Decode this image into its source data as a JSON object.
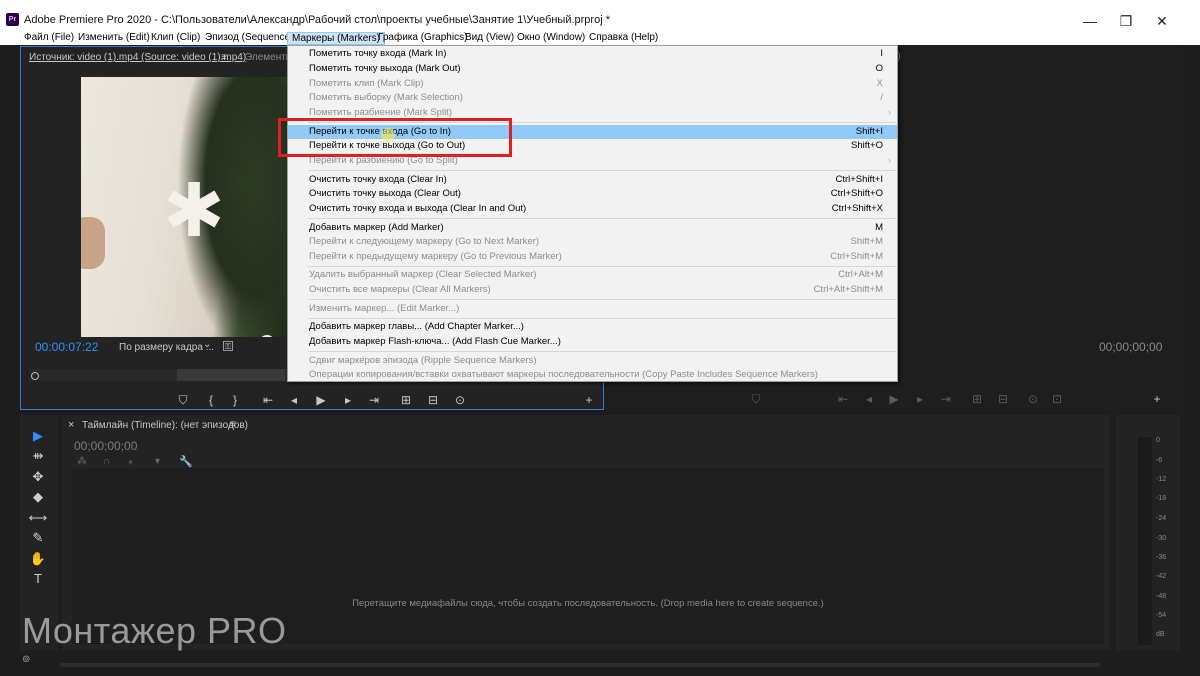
{
  "window": {
    "title": "Adobe Premiere Pro 2020 - C:\\Пользователи\\Александр\\Рабочий стол\\проекты учебные\\Занятие 1\\Учебный.prproj *",
    "app_icon": "Pr",
    "minimize": "—",
    "maximize": "❐",
    "close": "✕"
  },
  "menubar": [
    "Файл (File)",
    "Изменить (Edit)",
    "Клип (Clip)",
    "Эпизод (Sequence)",
    "Маркеры (Markers)",
    "Графика (Graphics)",
    "Вид (View)",
    "Окно (Window)",
    "Справка (Help)"
  ],
  "source_panel": {
    "tab_active": "Источник: video (1).mp4 (Source: video (1).mp4)",
    "tab_menu": "≡",
    "tab_other": "Элементы",
    "timecode": "00:00:07:22",
    "fit_dropdown": "По размеру кадра ...",
    "fit_dropdown_arrow": "⌄",
    "settings_icon": "⚿"
  },
  "program_panel": {
    "timecode": "00;00;00;00",
    "tab_partial": "r)"
  },
  "markers_menu": {
    "items": [
      {
        "label": "Пометить точку входа (Mark In)",
        "shortcut": "I",
        "disabled": false
      },
      {
        "label": "Пометить точку выхода (Mark Out)",
        "shortcut": "O",
        "disabled": false
      },
      {
        "label": "Пометить клип (Mark Clip)",
        "shortcut": "X",
        "disabled": true
      },
      {
        "label": "Пометить выборку (Mark Selection)",
        "shortcut": "/",
        "disabled": true
      },
      {
        "label": "Пометить разбиение (Mark Split)",
        "shortcut": "",
        "disabled": true,
        "submenu": true
      },
      {
        "label": "Перейти к точке входа (Go to In)",
        "shortcut": "Shift+I",
        "disabled": false,
        "highlighted": true
      },
      {
        "label": "Перейти к точке выхода (Go to Out)",
        "shortcut": "Shift+O",
        "disabled": false
      },
      {
        "label": "Перейти к разбиению (Go to Split)",
        "shortcut": "",
        "disabled": true,
        "submenu": true
      },
      {
        "label": "Очистить точку входа (Clear In)",
        "shortcut": "Ctrl+Shift+I",
        "disabled": false
      },
      {
        "label": "Очистить точку выхода (Clear Out)",
        "shortcut": "Ctrl+Shift+O",
        "disabled": false
      },
      {
        "label": "Очистить точку входа и выхода (Clear In and Out)",
        "shortcut": "Ctrl+Shift+X",
        "disabled": false
      },
      {
        "label": "Добавить маркер (Add Marker)",
        "shortcut": "M",
        "disabled": false
      },
      {
        "label": "Перейти к следующему маркеру (Go to Next Marker)",
        "shortcut": "Shift+M",
        "disabled": true
      },
      {
        "label": "Перейти к предыдущему маркеру (Go to Previous Marker)",
        "shortcut": "Ctrl+Shift+M",
        "disabled": true
      },
      {
        "label": "Удалить выбранный маркер (Clear Selected Marker)",
        "shortcut": "Ctrl+Alt+M",
        "disabled": true
      },
      {
        "label": "Очистить все маркеры (Clear All Markers)",
        "shortcut": "Ctrl+Alt+Shift+M",
        "disabled": true
      },
      {
        "label": "Изменить маркер... (Edit Marker...)",
        "shortcut": "",
        "disabled": true
      },
      {
        "label": "Добавить маркер главы... (Add Chapter Marker...)",
        "shortcut": "",
        "disabled": false
      },
      {
        "label": "Добавить маркер Flash-ключа... (Add Flash Cue Marker...)",
        "shortcut": "",
        "disabled": false
      },
      {
        "label": "Сдвиг маркеров эпизода (Ripple Sequence Markers)",
        "shortcut": "",
        "disabled": true
      },
      {
        "label": "Операции копирования/вставки охватывают маркеры последовательности (Copy Paste Includes Sequence Markers)",
        "shortcut": "",
        "disabled": true
      }
    ],
    "submenu_arrow": "›"
  },
  "transport": {
    "source_buttons": [
      "⛉",
      "{",
      "}",
      "⇤",
      "◂",
      "▶",
      "▸",
      "⇥",
      "⊞",
      "⊟",
      "⊙",
      "+"
    ],
    "program_buttons": [
      "⛉",
      "⇤",
      "◂",
      "▶",
      "▸",
      "⇥",
      "⊞",
      "⊟",
      "⊙",
      "⊡",
      "+"
    ]
  },
  "timeline": {
    "close": "×",
    "title": "Таймлайн (Timeline): (нет эпизодов)",
    "menu": "≡",
    "timecode": "00;00;00;00",
    "placeholder": "Перетащите медиафайлы сюда, чтобы создать последовательность. (Drop media here to create sequence.)",
    "header_icons": [
      "⁂",
      "∩",
      "⁎",
      "▾",
      "🔧"
    ]
  },
  "tools": [
    "▶",
    "⇻",
    "✥",
    "◆",
    "⟷",
    "✎",
    "✋",
    "T"
  ],
  "meters": {
    "ticks": [
      "0",
      "-6",
      "-12",
      "-18",
      "-24",
      "-30",
      "-36",
      "-42",
      "-48",
      "-54",
      "dB"
    ]
  },
  "watermark": "Монтажер PRO",
  "status": {
    "icon": "⊚"
  },
  "colors": {
    "accent_blue": "#2f8fff",
    "menu_highlight": "#91c9f7",
    "annotation_red": "#e02020"
  }
}
